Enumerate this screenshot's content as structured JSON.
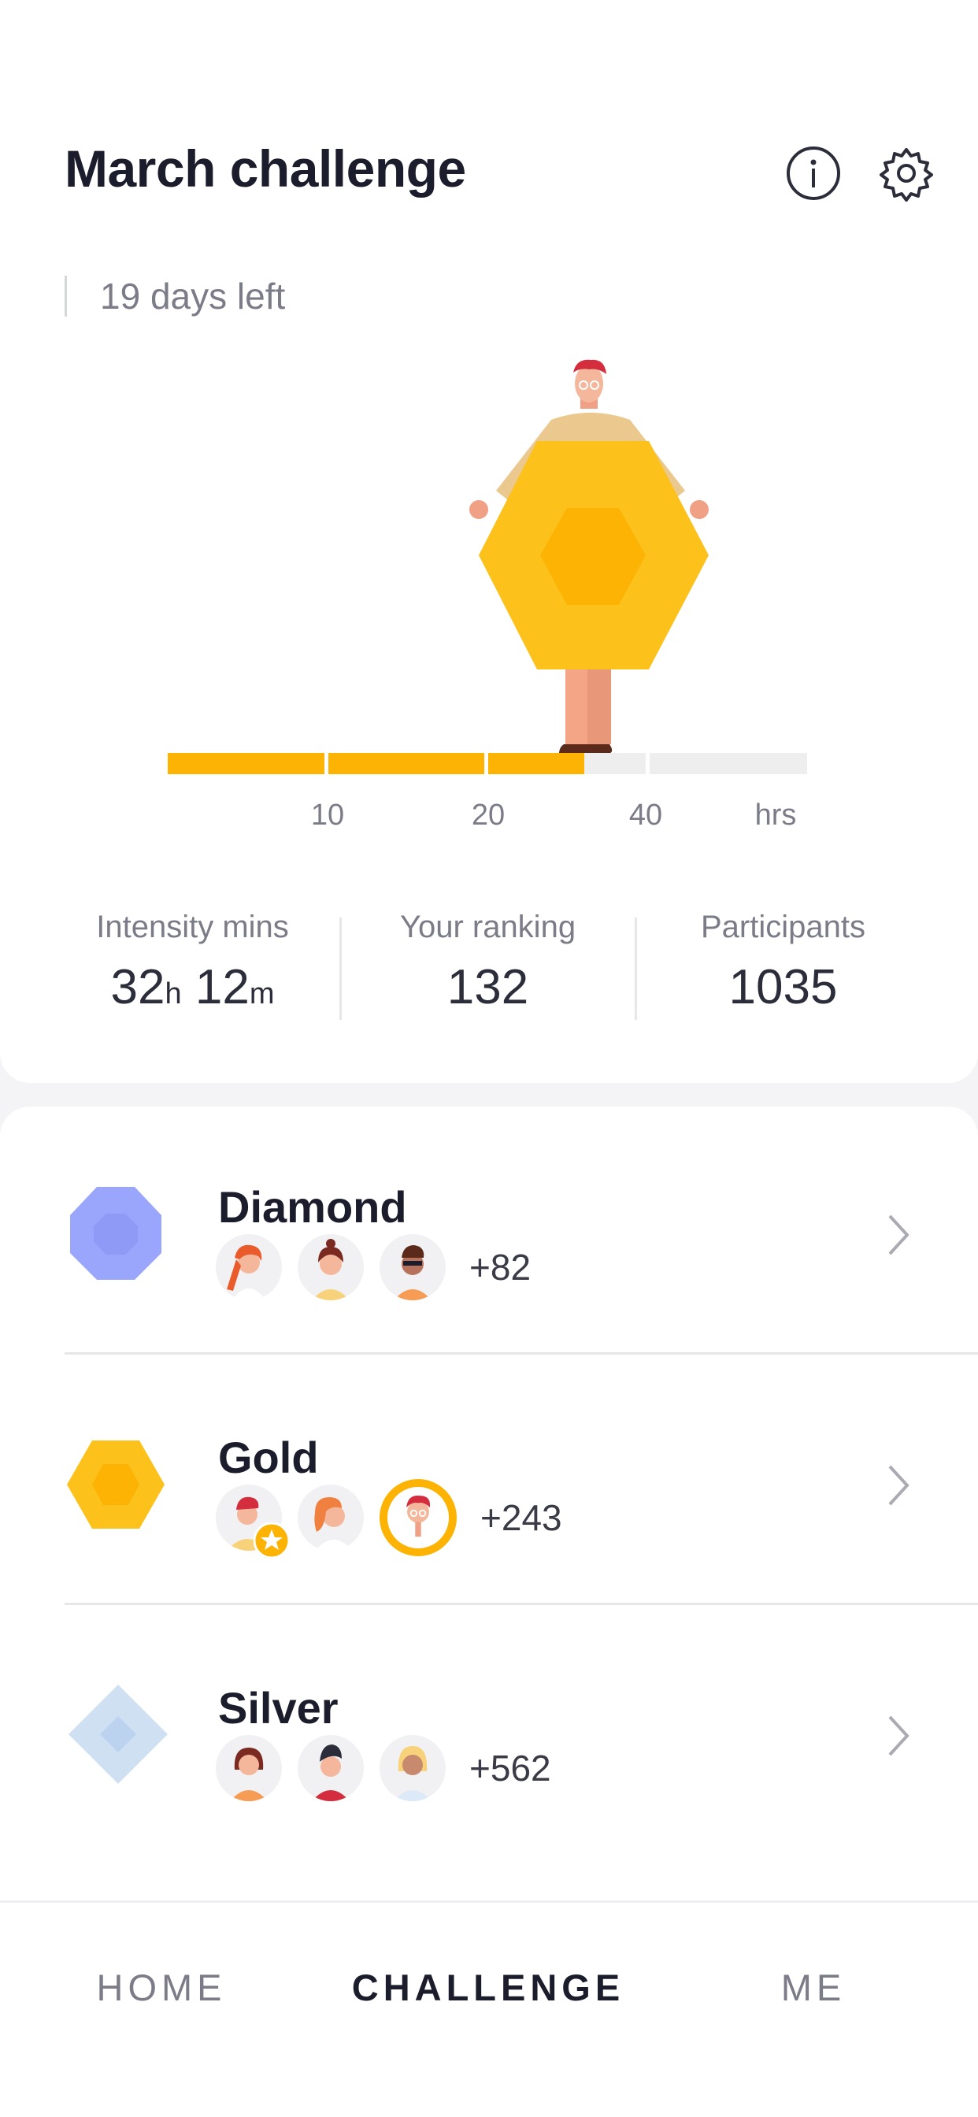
{
  "header": {
    "title": "March challenge",
    "days_left": "19 days left"
  },
  "icons": {
    "info": "info-icon",
    "settings": "gear-icon"
  },
  "progress": {
    "value_hours": 32.2,
    "ticks": [
      "10",
      "20",
      "40",
      "hrs"
    ],
    "color": "#fcb304"
  },
  "stats": {
    "intensity": {
      "label": "Intensity mins",
      "hours": "32",
      "h_unit": "h",
      "minutes": "12",
      "m_unit": "m"
    },
    "ranking": {
      "label": "Your ranking",
      "value": "132"
    },
    "participants": {
      "label": "Participants",
      "value": "1035"
    }
  },
  "tiers": [
    {
      "name": "Diamond",
      "extra": "+82",
      "color": "#9aa6fb"
    },
    {
      "name": "Gold",
      "extra": "+243",
      "color": "#fcc21b"
    },
    {
      "name": "Silver",
      "extra": "+562",
      "color": "#cfe0f3"
    }
  ],
  "nav": {
    "home": "HOME",
    "challenge": "CHALLENGE",
    "me": "ME",
    "active": "CHALLENGE"
  }
}
